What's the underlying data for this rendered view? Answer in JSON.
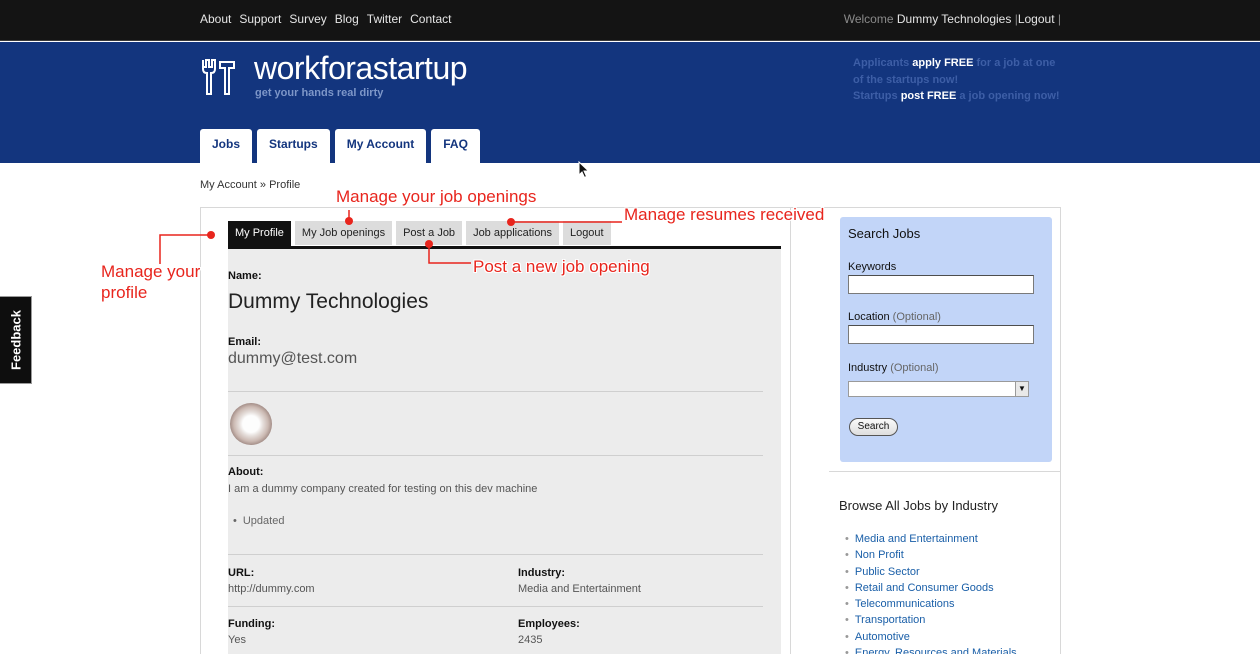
{
  "topbar": {
    "links": [
      "About",
      "Support",
      "Survey",
      "Blog",
      "Twitter",
      "Contact"
    ],
    "welcome_prefix": "Welcome",
    "user_name": "Dummy Technologies",
    "sep1": "|",
    "logout_label": "Logout",
    "sep2": "|"
  },
  "header": {
    "logo_text": "workforastartup",
    "tagline": "get your hands real dirty",
    "promo_line1_pre": "Applicants",
    "promo_line1_bold": "apply FREE",
    "promo_line1_post": "for a job at one of the startups now!",
    "promo_line2_pre": "Startups",
    "promo_line2_bold": "post FREE",
    "promo_line2_post": "a job opening now!",
    "tabs": [
      "Jobs",
      "Startups",
      "My Account",
      "FAQ"
    ],
    "active_tab": "My Account"
  },
  "breadcrumb": "My Account » Profile",
  "subtabs": [
    "My Profile",
    "My Job openings",
    "Post a Job",
    "Job applications",
    "Logout"
  ],
  "profile": {
    "name_label": "Name:",
    "name": "Dummy Technologies",
    "email_label": "Email:",
    "email": "dummy@test.com",
    "about_label": "About:",
    "about": "I am a dummy company created for testing on this dev machine",
    "bullet": "Updated",
    "url_label": "URL:",
    "url": "http://dummy.com",
    "industry_label": "Industry:",
    "industry": "Media and Entertainment",
    "funding_label": "Funding:",
    "funding": "Yes",
    "employees_label": "Employees:",
    "employees": "2435"
  },
  "search": {
    "title": "Search Jobs",
    "keywords_label": "Keywords",
    "location_label": "Location",
    "location_opt": "(Optional)",
    "industry_label": "Industry",
    "industry_opt": "(Optional)",
    "button": "Search"
  },
  "browse": {
    "title": "Browse All Jobs by Industry",
    "items": [
      "Media and Entertainment",
      "Non Profit",
      "Public Sector",
      "Retail and Consumer Goods",
      "Telecommunications",
      "Transportation",
      "Automotive",
      "Energy, Resources and Materials"
    ]
  },
  "feedback": "Feedback",
  "annotations": {
    "profile": "Manage your profile",
    "openings": "Manage your job openings",
    "resumes": "Manage resumes received",
    "post": "Post a new job opening"
  },
  "colors": {
    "header_blue": "#13357e",
    "annotation_red": "#e8251d",
    "search_panel": "#c2d5f8"
  }
}
